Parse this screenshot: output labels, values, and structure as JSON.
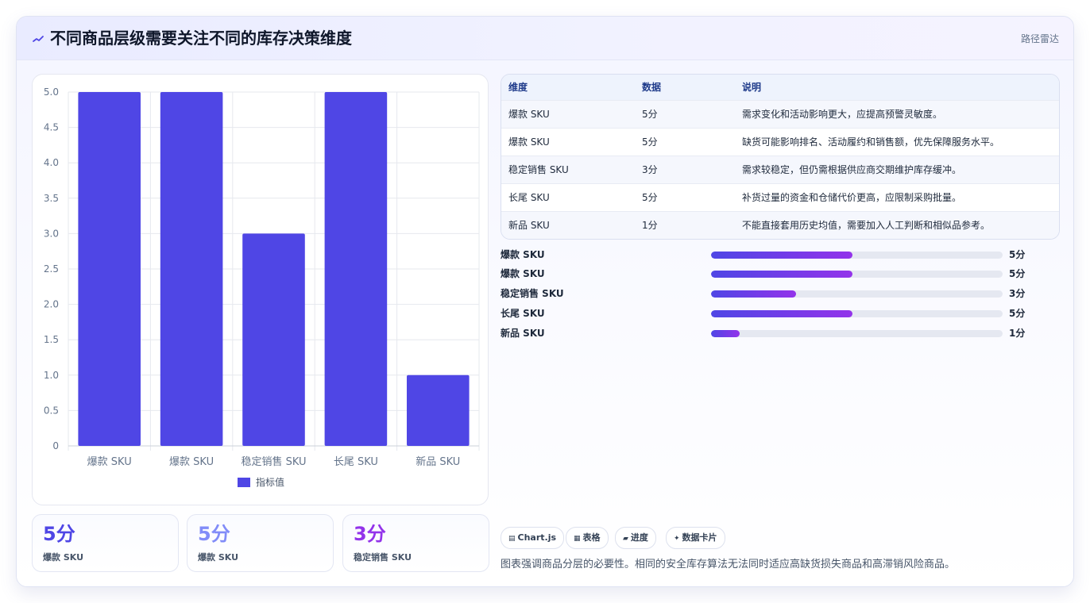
{
  "header": {
    "title": "不同商品层级需要关注不同的库存决策维度",
    "badge": "路径雷达",
    "icon": "sparkline-icon"
  },
  "chart_data": {
    "type": "bar",
    "categories": [
      "爆款 SKU",
      "爆款 SKU",
      "稳定销售 SKU",
      "长尾 SKU",
      "新品 SKU"
    ],
    "series": [
      {
        "name": "指标值",
        "values": [
          5,
          5,
          3,
          5,
          1
        ]
      }
    ],
    "ylim": [
      0,
      5
    ],
    "yticks": [
      "0",
      "0.5",
      "1.0",
      "1.5",
      "2.0",
      "2.5",
      "3.0",
      "3.5",
      "4.0",
      "4.5",
      "5.0"
    ],
    "ytick_values": [
      0,
      0.5,
      1,
      1.5,
      2,
      2.5,
      3,
      3.5,
      4,
      4.5,
      5
    ],
    "grid": true,
    "legend_position": "bottom",
    "bar_color": "#4f46e5"
  },
  "stats": [
    {
      "value": "5分",
      "label": "爆款 SKU",
      "color": "#4f46e5"
    },
    {
      "value": "5分",
      "label": "爆款 SKU",
      "color": "#818cf8"
    },
    {
      "value": "3分",
      "label": "稳定销售 SKU",
      "color": "#9333ea"
    }
  ],
  "table": {
    "headers": [
      "维度",
      "数据",
      "说明"
    ],
    "rows": [
      [
        "爆款 SKU",
        "5分",
        "需求变化和活动影响更大，应提高预警灵敏度。"
      ],
      [
        "爆款 SKU",
        "5分",
        "缺货可能影响排名、活动履约和销售额，优先保障服务水平。"
      ],
      [
        "稳定销售 SKU",
        "3分",
        "需求较稳定，但仍需根据供应商交期维护库存缓冲。"
      ],
      [
        "长尾 SKU",
        "5分",
        "补货过量的资金和仓储代价更高，应限制采购批量。"
      ],
      [
        "新品 SKU",
        "1分",
        "不能直接套用历史均值，需要加入人工判断和相似品参考。"
      ]
    ]
  },
  "progress": [
    {
      "label": "爆款 SKU",
      "value": "5分",
      "fraction": 0.486
    },
    {
      "label": "爆款 SKU",
      "value": "5分",
      "fraction": 0.486
    },
    {
      "label": "稳定销售 SKU",
      "value": "3分",
      "fraction": 0.292
    },
    {
      "label": "长尾 SKU",
      "value": "5分",
      "fraction": 0.486
    },
    {
      "label": "新品 SKU",
      "value": "1分",
      "fraction": 0.097
    }
  ],
  "chips": [
    {
      "icon": "chart-icon",
      "glyph": "▤",
      "label": "Chart.js"
    },
    {
      "icon": "table-icon",
      "glyph": "▦",
      "label": "表格"
    },
    {
      "icon": "progress-icon",
      "glyph": "▰",
      "label": "进度"
    },
    {
      "icon": "sparkle-icon",
      "glyph": "✦",
      "label": "数据卡片"
    }
  ],
  "footnote": "图表强调商品分层的必要性。相同的安全库存算法无法同时适应高缺货损失商品和高滞销风险商品。"
}
